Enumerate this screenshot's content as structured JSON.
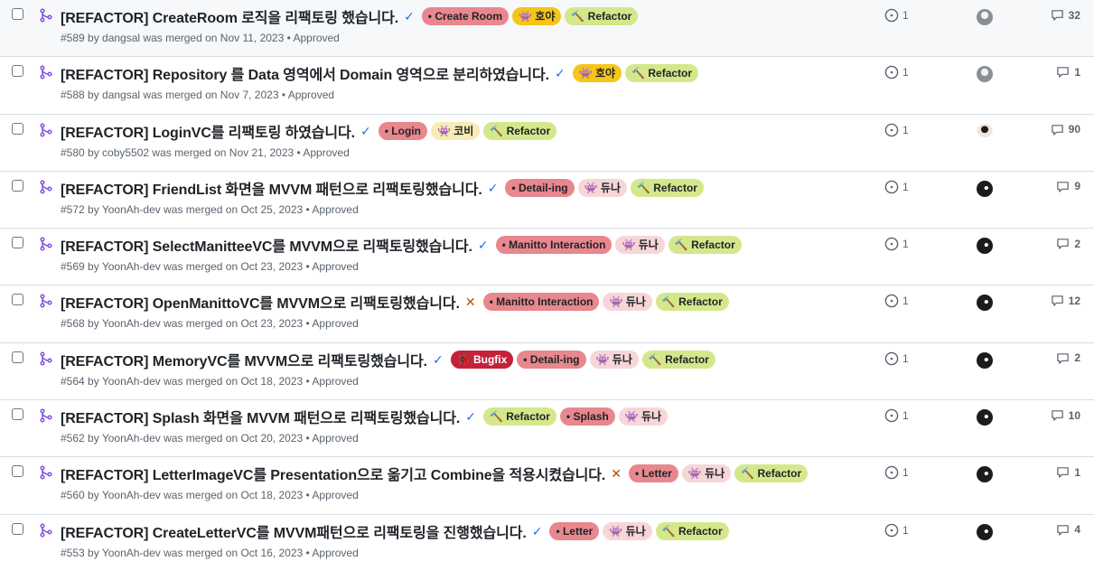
{
  "colors": {
    "refactor": "#d4e88b",
    "create_room": "#e8878d",
    "login": "#e8878d",
    "detail_ing": "#e8878d",
    "manitto_interaction": "#e8878d",
    "letter": "#e8878d",
    "splash": "#e8878d",
    "bugfix": "#c4213b",
    "hoya": "#f5c518",
    "kobi": "#f8ecb6",
    "duna": "#f7d6d8"
  },
  "pull_requests": [
    {
      "title": "[REFACTOR] CreateRoom 로직을 리팩토링 했습니다.",
      "status": "✓",
      "status_kind": "ok",
      "labels": [
        {
          "text": "• Create Room",
          "kind": "create_room"
        },
        {
          "text": "👾 호야",
          "kind": "hoya"
        },
        {
          "text": "🔨 Refactor",
          "kind": "refactor"
        }
      ],
      "meta": "#589 by dangsal was merged on Nov 11, 2023 • Approved",
      "issues": "1",
      "avatar": "avatar-a",
      "comments": "32"
    },
    {
      "title": "[REFACTOR] Repository 를 Data 영역에서 Domain 영역으로 분리하였습니다.",
      "status": "✓",
      "status_kind": "ok",
      "labels": [
        {
          "text": "👾 호야",
          "kind": "hoya"
        },
        {
          "text": "🔨 Refactor",
          "kind": "refactor"
        }
      ],
      "meta": "#588 by dangsal was merged on Nov 7, 2023 • Approved",
      "issues": "1",
      "avatar": "avatar-a",
      "comments": "1"
    },
    {
      "title": "[REFACTOR] LoginVC를 리팩토링 하였습니다.",
      "status": "✓",
      "status_kind": "ok",
      "labels": [
        {
          "text": "• Login",
          "kind": "login"
        },
        {
          "text": "👾 코비",
          "kind": "kobi"
        },
        {
          "text": "🔨 Refactor",
          "kind": "refactor"
        }
      ],
      "meta": "#580 by coby5502 was merged on Nov 21, 2023 • Approved",
      "issues": "1",
      "avatar": "avatar-b",
      "comments": "90"
    },
    {
      "title": "[REFACTOR] FriendList 화면을 MVVM 패턴으로 리팩토링했습니다.",
      "status": "✓",
      "status_kind": "ok",
      "labels": [
        {
          "text": "• Detail-ing",
          "kind": "detail_ing"
        },
        {
          "text": "👾 듀나",
          "kind": "duna"
        },
        {
          "text": "🔨 Refactor",
          "kind": "refactor"
        }
      ],
      "meta": "#572 by YoonAh-dev was merged on Oct 25, 2023 • Approved",
      "issues": "1",
      "avatar": "avatar-c",
      "comments": "9"
    },
    {
      "title": "[REFACTOR] SelectManitteeVC를 MVVM으로 리팩토링했습니다.",
      "status": "✓",
      "status_kind": "ok",
      "labels": [
        {
          "text": "• Manitto Interaction",
          "kind": "manitto_interaction"
        },
        {
          "text": "👾 듀나",
          "kind": "duna"
        },
        {
          "text": "🔨 Refactor",
          "kind": "refactor"
        }
      ],
      "meta": "#569 by YoonAh-dev was merged on Oct 23, 2023 • Approved",
      "issues": "1",
      "avatar": "avatar-c",
      "comments": "2"
    },
    {
      "title": "[REFACTOR] OpenManittoVC를 MVVM으로 리팩토링했습니다.",
      "status": "✕",
      "status_kind": "fail",
      "labels": [
        {
          "text": "• Manitto Interaction",
          "kind": "manitto_interaction"
        },
        {
          "text": "👾 듀나",
          "kind": "duna"
        },
        {
          "text": "🔨 Refactor",
          "kind": "refactor"
        }
      ],
      "meta": "#568 by YoonAh-dev was merged on Oct 23, 2023 • Approved",
      "issues": "1",
      "avatar": "avatar-c",
      "comments": "12"
    },
    {
      "title": "[REFACTOR] MemoryVC를 MVVM으로 리팩토링했습니다.",
      "status": "✓",
      "status_kind": "ok",
      "labels": [
        {
          "text": "🐞 Bugfix",
          "kind": "bugfix"
        },
        {
          "text": "• Detail-ing",
          "kind": "detail_ing"
        },
        {
          "text": "👾 듀나",
          "kind": "duna"
        },
        {
          "text": "🔨 Refactor",
          "kind": "refactor"
        }
      ],
      "meta": "#564 by YoonAh-dev was merged on Oct 18, 2023 • Approved",
      "issues": "1",
      "avatar": "avatar-c",
      "comments": "2"
    },
    {
      "title": "[REFACTOR] Splash 화면을 MVVM 패턴으로 리팩토링했습니다.",
      "status": "✓",
      "status_kind": "ok",
      "labels": [
        {
          "text": "🔨 Refactor",
          "kind": "refactor"
        },
        {
          "text": "• Splash",
          "kind": "splash"
        },
        {
          "text": "👾 듀나",
          "kind": "duna"
        }
      ],
      "meta": "#562 by YoonAh-dev was merged on Oct 20, 2023 • Approved",
      "issues": "1",
      "avatar": "avatar-c",
      "comments": "10"
    },
    {
      "title": "[REFACTOR] LetterImageVC를 Presentation으로 옮기고 Combine을 적용시켰습니다.",
      "status": "✕",
      "status_kind": "fail",
      "labels": [
        {
          "text": "• Letter",
          "kind": "letter"
        },
        {
          "text": "👾 듀나",
          "kind": "duna"
        },
        {
          "text": "🔨 Refactor",
          "kind": "refactor"
        }
      ],
      "meta": "#560 by YoonAh-dev was merged on Oct 18, 2023 • Approved",
      "issues": "1",
      "avatar": "avatar-c",
      "comments": "1"
    },
    {
      "title": "[REFACTOR] CreateLetterVC를 MVVM패턴으로 리팩토링을 진행했습니다.",
      "status": "✓",
      "status_kind": "ok",
      "labels": [
        {
          "text": "• Letter",
          "kind": "letter"
        },
        {
          "text": "👾 듀나",
          "kind": "duna"
        },
        {
          "text": "🔨 Refactor",
          "kind": "refactor"
        }
      ],
      "meta": "#553 by YoonAh-dev was merged on Oct 16, 2023 • Approved",
      "issues": "1",
      "avatar": "avatar-c",
      "comments": "4"
    }
  ]
}
